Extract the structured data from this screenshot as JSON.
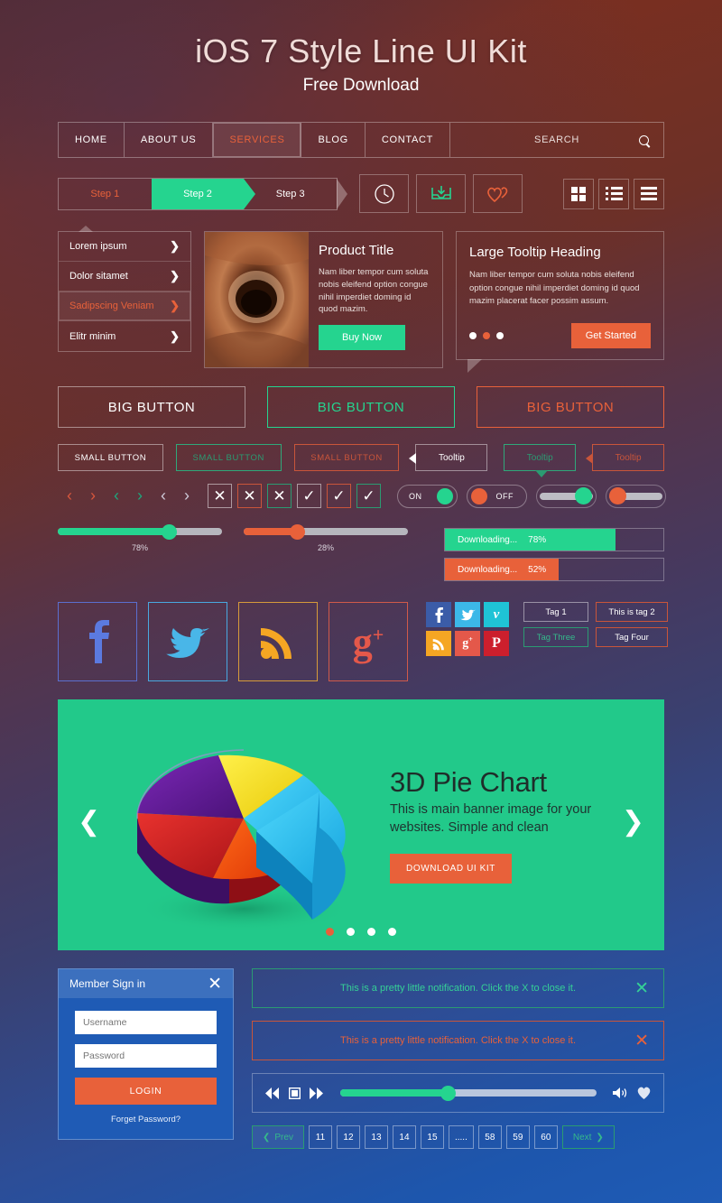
{
  "header": {
    "title": "iOS 7 Style Line UI Kit",
    "subtitle": "Free Download"
  },
  "nav": {
    "items": [
      "HOME",
      "ABOUT US",
      "SERVICES",
      "BLOG",
      "CONTACT"
    ],
    "active": "SERVICES",
    "search_label": "SEARCH",
    "search_icon": "search-icon"
  },
  "steps": {
    "items": [
      "Step 1",
      "Step 2",
      "Step 3"
    ],
    "active_index": 1
  },
  "icon_buttons": [
    {
      "name": "clock-icon",
      "color": "#ffffff"
    },
    {
      "name": "inbox-download-icon",
      "color": "#25d48f"
    },
    {
      "name": "double-heart-icon",
      "color": "#e8613a"
    }
  ],
  "view_buttons": [
    {
      "name": "grid-view-icon"
    },
    {
      "name": "list-view-icon"
    },
    {
      "name": "menu-view-icon"
    }
  ],
  "list_card": {
    "items": [
      "Lorem ipsum",
      "Dolor sitamet",
      "Sadipscing Veniam",
      "Elitr minim"
    ],
    "highlighted_index": 2,
    "chevron_icon": "chevron-right-icon"
  },
  "product_card": {
    "title": "Product Title",
    "body": "Nam liber tempor cum soluta nobis eleifend option congue nihil imperdiet doming id quod mazim.",
    "button": "Buy Now",
    "image_alt": "clay-pot-photo"
  },
  "tooltip_card": {
    "title": "Large Tooltip Heading",
    "body": "Nam liber tempor cum soluta nobis eleifend option congue nihil imperdiet doming id quod mazim placerat facer possim assum.",
    "button": "Get Started",
    "dots_count": 3,
    "dots_active_index": 1
  },
  "big_buttons": [
    {
      "label": "BIG BUTTON",
      "variant": "white"
    },
    {
      "label": "BIG BUTTON",
      "variant": "green"
    },
    {
      "label": "BIG BUTTON",
      "variant": "orange"
    }
  ],
  "small_buttons": [
    {
      "label": "SMALL BUTTON",
      "variant": "white"
    },
    {
      "label": "SMALL BUTTON",
      "variant": "green"
    },
    {
      "label": "SMALL BUTTON",
      "variant": "orange"
    }
  ],
  "tooltips": [
    {
      "label": "Tooltip",
      "variant": "white",
      "arrow": "left"
    },
    {
      "label": "Tooltip",
      "variant": "green",
      "arrow": "bottom"
    },
    {
      "label": "Tooltip",
      "variant": "orange",
      "arrow": "left"
    }
  ],
  "arrow_pairs": [
    {
      "prev": "‹",
      "next": "›",
      "variant": "orange"
    },
    {
      "prev": "‹",
      "next": "›",
      "variant": "green"
    },
    {
      "prev": "‹",
      "next": "›",
      "variant": "white"
    }
  ],
  "checkboxes": [
    {
      "glyph": "✕",
      "name": "close-icon",
      "variant": "white"
    },
    {
      "glyph": "✕",
      "name": "close-icon",
      "variant": "orange"
    },
    {
      "glyph": "✕",
      "name": "close-icon",
      "variant": "green"
    },
    {
      "glyph": "✓",
      "name": "check-icon",
      "variant": "white"
    },
    {
      "glyph": "✓",
      "name": "check-icon",
      "variant": "orange"
    },
    {
      "glyph": "✓",
      "name": "check-icon",
      "variant": "green"
    }
  ],
  "toggles": [
    {
      "label": "ON",
      "state": "on",
      "knob_color": "#25d48f"
    },
    {
      "label": "OFF",
      "state": "off",
      "knob_color": "#e8613a"
    },
    {
      "label": "",
      "state": "on",
      "knob_color": "#25d48f"
    },
    {
      "label": "",
      "state": "off",
      "knob_color": "#e8613a"
    }
  ],
  "sliders": [
    {
      "value": 78,
      "label": "78%",
      "color": "#25d48f"
    },
    {
      "value": 28,
      "label": "28%",
      "color": "#e8613a"
    }
  ],
  "progress_bars": [
    {
      "label": "Downloading...",
      "value": "78%",
      "percent": 78,
      "color": "#25d48f"
    },
    {
      "label": "Downloading...",
      "value": "52%",
      "percent": 52,
      "color": "#e8613a"
    }
  ],
  "big_social": [
    {
      "name": "facebook-icon",
      "glyph": "f",
      "color": "#5b7ae0"
    },
    {
      "name": "twitter-icon",
      "glyph": "🐦",
      "color": "#49b6e8"
    },
    {
      "name": "rss-icon",
      "glyph": "rss",
      "color": "#f5a623"
    },
    {
      "name": "googleplus-icon",
      "glyph": "g+",
      "color": "#e4584a"
    }
  ],
  "small_social": [
    {
      "name": "facebook-icon",
      "glyph": "f",
      "bg": "#3b5ca8"
    },
    {
      "name": "twitter-icon",
      "glyph": "t",
      "bg": "#3cb8e8"
    },
    {
      "name": "vimeo-icon",
      "glyph": "v",
      "bg": "#1fc3d6"
    },
    {
      "name": "rss-icon",
      "glyph": "r",
      "bg": "#f5a623"
    },
    {
      "name": "googleplus-icon",
      "glyph": "g+",
      "bg": "#e4584a"
    },
    {
      "name": "pinterest-icon",
      "glyph": "P",
      "bg": "#cc1f2d"
    }
  ],
  "tags": [
    {
      "label": "Tag 1",
      "variant": "white"
    },
    {
      "label": "This is tag 2",
      "variant": "orange"
    },
    {
      "label": "Tag Three",
      "variant": "green"
    },
    {
      "label": "Tag Four",
      "variant": "orange"
    }
  ],
  "banner": {
    "title": "3D Pie Chart",
    "body": "This is main banner image for your websites. Simple and clean",
    "button": "DOWNLOAD UI KIT",
    "prev_icon": "chevron-left-icon",
    "next_icon": "chevron-right-icon",
    "dots_count": 4,
    "dots_active_index": 0,
    "bg_color": "#22c98a"
  },
  "chart_data": {
    "type": "pie",
    "title": "3D Pie Chart",
    "labels": [
      "Yellow",
      "Cyan",
      "Red",
      "Purple",
      "Orange"
    ],
    "values": [
      22,
      27,
      21,
      22,
      8
    ],
    "colors": [
      "#f5e024",
      "#29bdf0",
      "#d8262a",
      "#5b1f8c",
      "#f04a16"
    ],
    "legend": false,
    "grid": false
  },
  "signin": {
    "title": "Member Sign in",
    "close_icon": "close-icon",
    "username_placeholder": "Username",
    "password_placeholder": "Password",
    "login_label": "LOGIN",
    "forgot_label": "Forget Password?"
  },
  "notifications": [
    {
      "text": "This is a pretty little notification. Click the X to close it.",
      "variant": "green",
      "close_icon": "close-icon"
    },
    {
      "text": "This is a pretty little notification. Click the X to close it.",
      "variant": "orange",
      "close_icon": "close-icon"
    }
  ],
  "player": {
    "rewind_icon": "rewind-icon",
    "stop_icon": "stop-icon",
    "forward_icon": "fast-forward-icon",
    "volume_icon": "volume-icon",
    "favorite_icon": "heart-icon",
    "progress_percent": 42
  },
  "pagination": {
    "prev_label": "Prev",
    "next_label": "Next",
    "pages": [
      "11",
      "12",
      "13",
      "14",
      "15",
      ".....",
      "58",
      "59",
      "60"
    ]
  },
  "colors": {
    "green": "#25d48f",
    "orange": "#e8613a",
    "blue": "#1f5bb5",
    "banner_green": "#22c98a"
  }
}
